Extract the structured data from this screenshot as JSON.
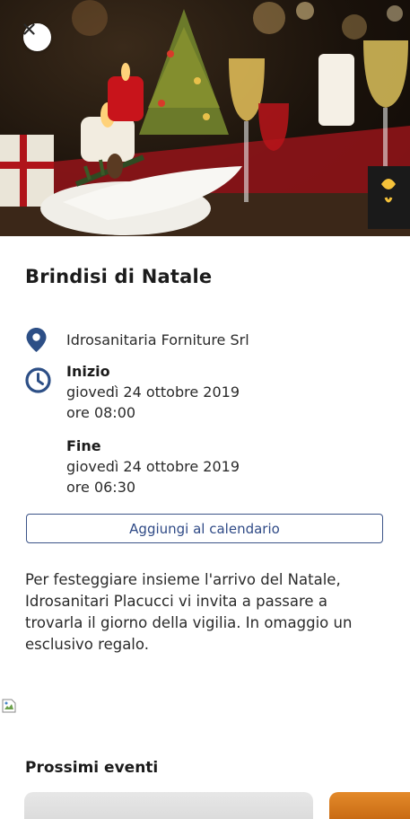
{
  "event": {
    "title": "Brindisi di Natale",
    "location": "Idrosanitaria Forniture Srl",
    "start_label": "Inizio",
    "start_date": "giovedì 24 ottobre 2019",
    "start_time": "ore 08:00",
    "end_label": "Fine",
    "end_date": "giovedì 24 ottobre 2019",
    "end_time": "ore 06:30",
    "add_to_calendar": "Aggiungi al calendario",
    "description": "Per festeggiare insieme l'arrivo del Natale, Idrosanitari Placucci vi invita a passare a trovarla il giorno della vigilia. In omaggio un esclusivo regalo."
  },
  "upcoming": {
    "title": "Prossimi eventi"
  },
  "icons": {
    "close": "close-icon",
    "location": "location-pin-icon",
    "time": "clock-icon"
  },
  "colors": {
    "accent": "#2f4a86",
    "icon": "#2d4f86"
  }
}
